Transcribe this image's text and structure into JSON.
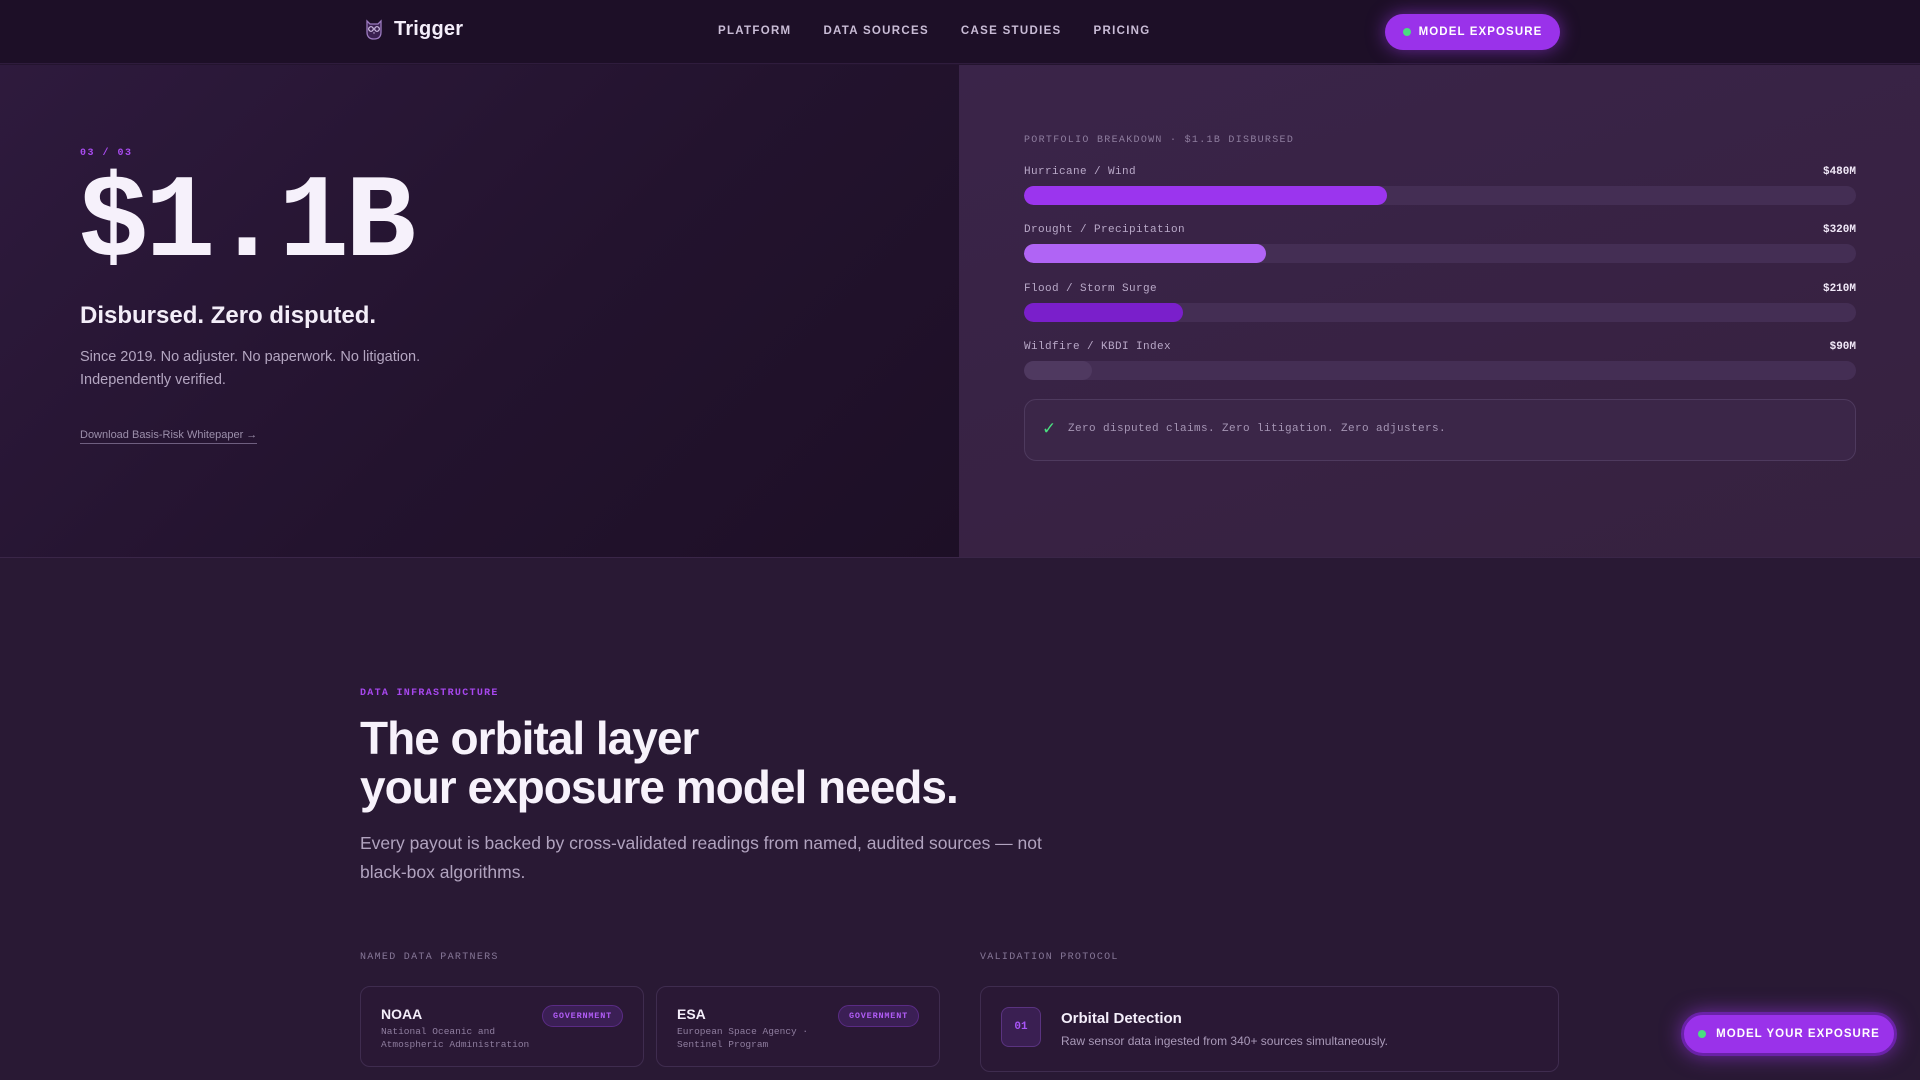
{
  "nav": {
    "brand": "Trigger",
    "links": [
      "PLATFORM",
      "DATA SOURCES",
      "CASE STUDIES",
      "PRICING"
    ],
    "cta_label": "MODEL EXPOSURE"
  },
  "hero": {
    "step": "03 / 03",
    "stat": "$1.1B",
    "subtitle": "Disbursed. Zero disputed.",
    "description": "Since 2019. No adjuster. No paperwork. No litigation. Independently verified.",
    "link": "Download Basis-Risk Whitepaper →"
  },
  "breakdown": {
    "title": "PORTFOLIO BREAKDOWN · $1.1B DISBURSED",
    "max_value": 1100,
    "rows": [
      {
        "label": "Hurricane / Wind",
        "value_text": "$480M",
        "amount": 480,
        "color": "#9b35ee"
      },
      {
        "label": "Drought / Precipitation",
        "value_text": "$320M",
        "amount": 320,
        "color": "#b064f5"
      },
      {
        "label": "Flood / Storm Surge",
        "value_text": "$210M",
        "amount": 210,
        "color": "#7a1fcb"
      },
      {
        "label": "Wildfire / KBDI Index",
        "value_text": "$90M",
        "amount": 90,
        "color": "#4f3960"
      }
    ],
    "note": "Zero disputed claims. Zero litigation. Zero adjusters."
  },
  "section": {
    "eyebrow": "DATA INFRASTRUCTURE",
    "title_line1": "The orbital layer",
    "title_line2": "your exposure model needs.",
    "description": "Every payout is backed by cross-validated readings from named, audited sources — not black-box algorithms.",
    "partners_label": "NAMED DATA PARTNERS",
    "partners": [
      {
        "name": "NOAA",
        "description": "National Oceanic and Atmospheric Administration",
        "badge": "GOVERNMENT"
      },
      {
        "name": "ESA",
        "description": "European Space Agency · Sentinel Program",
        "badge": "GOVERNMENT"
      }
    ],
    "validation_label": "VALIDATION PROTOCOL",
    "steps": [
      {
        "num": "01",
        "title": "Orbital Detection",
        "description": "Raw sensor data ingested from 340+ sources simultaneously."
      }
    ]
  },
  "floating_cta": {
    "label": "MODEL YOUR EXPOSURE"
  },
  "colors": {
    "accent": "#9a32ea",
    "status_dot": "#4ade80",
    "background": "#24142f"
  }
}
